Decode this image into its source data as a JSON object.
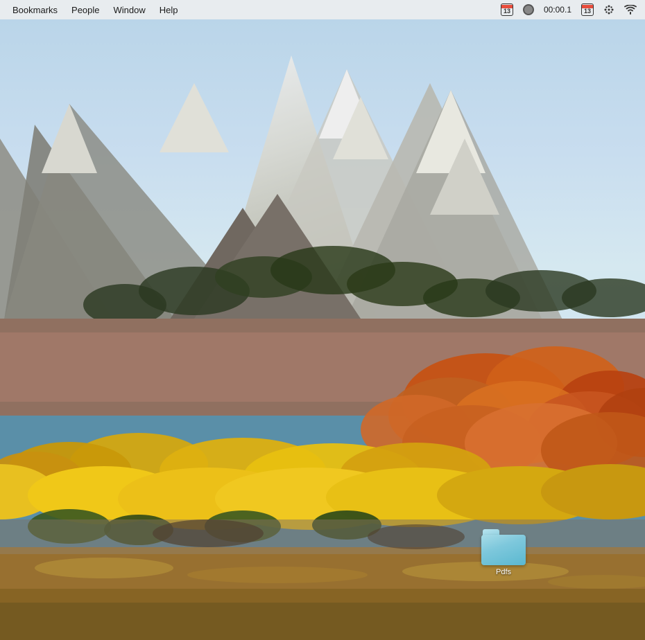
{
  "menubar": {
    "items": [
      {
        "label": "Bookmarks",
        "name": "bookmarks-menu"
      },
      {
        "label": "People",
        "name": "people-menu"
      },
      {
        "label": "Window",
        "name": "window-menu"
      },
      {
        "label": "Help",
        "name": "help-menu"
      }
    ],
    "status": {
      "calendar_number": "13",
      "record_indicator": "●",
      "timer": "00:00.1",
      "calendar_number2": "13"
    }
  },
  "desktop": {
    "folder": {
      "label": "Pdfs",
      "name": "pdfs-folder"
    }
  }
}
